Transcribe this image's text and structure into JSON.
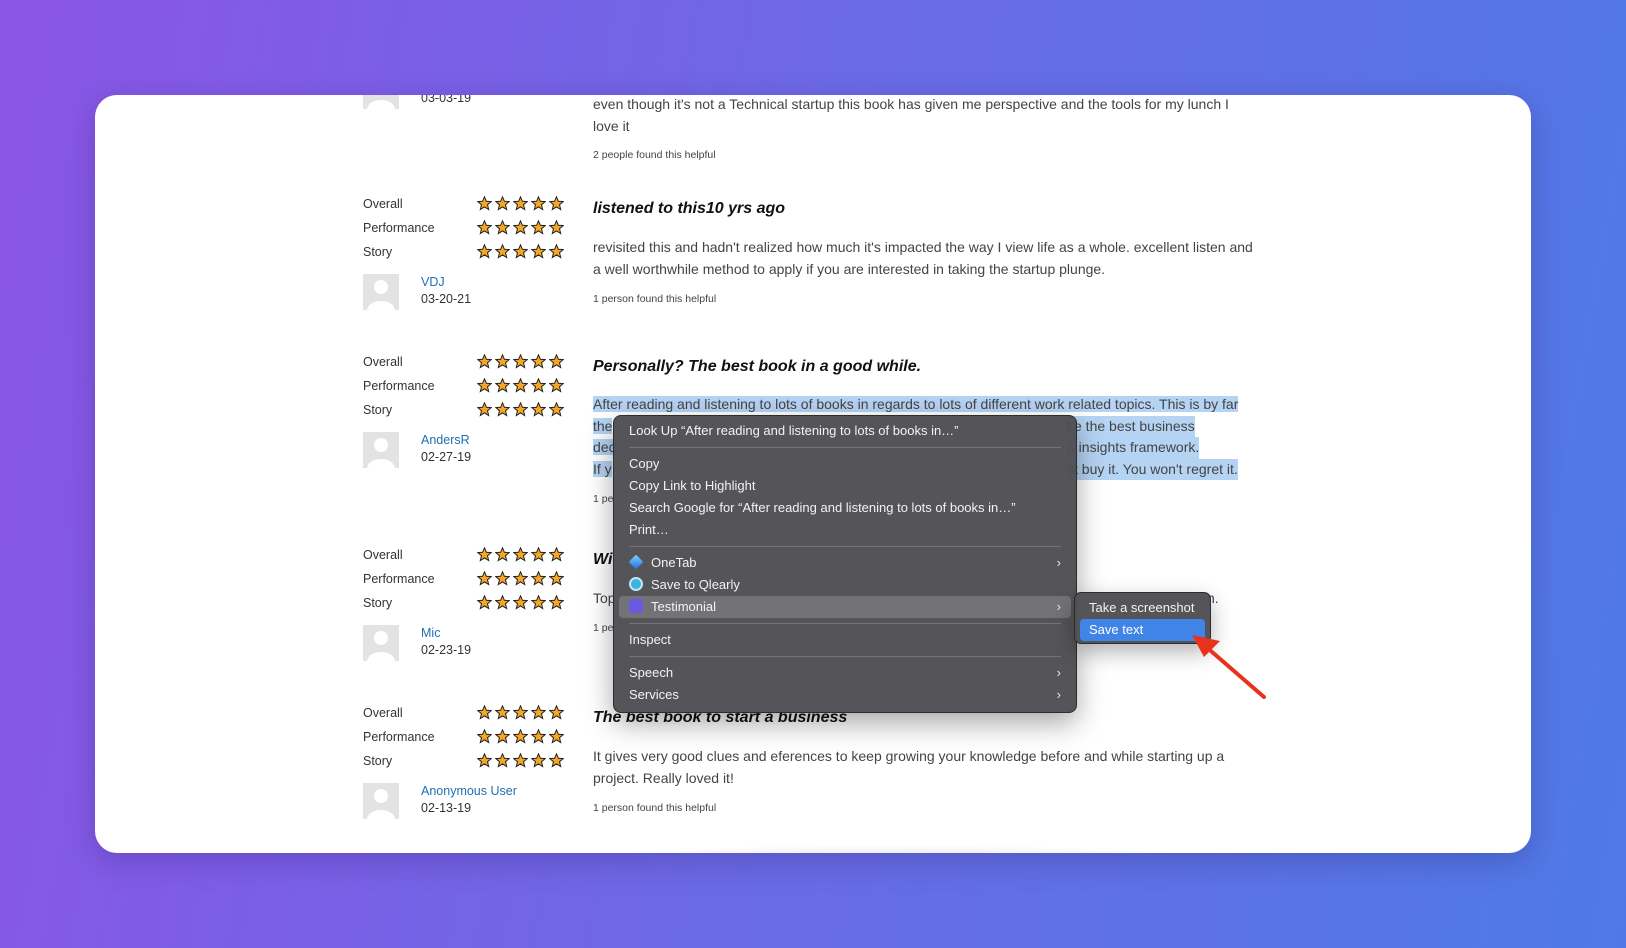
{
  "top_review": {
    "date_partial": "03-03-19",
    "body": "even though it's not a Technical startup this book has given me perspective and the tools for my lunch I love it",
    "helpful": "2 people found this helpful"
  },
  "rating_labels": {
    "overall": "Overall",
    "performance": "Performance",
    "story": "Story"
  },
  "reviews": [
    {
      "user": "VDJ",
      "date": "03-20-21",
      "title": "listened to this10 yrs ago",
      "body": "revisited this and hadn't realized how much it's impacted the way I view life as a whole. excellent listen and a well worthwhile method to apply if you are interested in taking the startup plunge.",
      "helpful": "1 person found this helpful",
      "ratings": {
        "overall": 5,
        "performance": 5,
        "story": 5
      }
    },
    {
      "user": "AndersR",
      "date": "02-27-19",
      "title": "Personally? The best book in a good while.",
      "body_line1_left": "After reading and listening to lots of books in regards to lots of different work related topics. This is by far",
      "body_line2_left": "the",
      "body_line2_right": "ke the best business",
      "body_line3_left": "dec",
      "body_line3_right": "n insights framework.",
      "body_line4_left": "If y",
      "body_line4_right": "st buy it. You won't regret it.",
      "helpful": "1 pe",
      "ratings": {
        "overall": 5,
        "performance": 5,
        "story": 5
      }
    },
    {
      "user": "Mic",
      "date": "02-23-19",
      "title": "Wi",
      "body_left": "Top",
      "body_right": "n.",
      "helpful": "1 pe",
      "ratings": {
        "overall": 5,
        "performance": 5,
        "story": 5
      }
    },
    {
      "user": "Anonymous User",
      "date": "02-13-19",
      "title": "The best book to start a business",
      "body": "It gives very good clues and eferences to keep growing your knowledge before and while starting up a project. Really loved it!",
      "helpful": "1 person found this helpful",
      "ratings": {
        "overall": 5,
        "performance": 5,
        "story": 5
      }
    }
  ],
  "context_menu": {
    "look_up": "Look Up “After reading and listening to lots of books in…”",
    "copy": "Copy",
    "copy_link": "Copy Link to Highlight",
    "search_google": "Search Google for “After reading and listening to lots of books in…”",
    "print": "Print…",
    "onetab": "OneTab",
    "save_qlearly": "Save to Qlearly",
    "testimonial": "Testimonial",
    "inspect": "Inspect",
    "speech": "Speech",
    "services": "Services"
  },
  "submenu": {
    "take_screenshot": "Take a screenshot",
    "save_text": "Save text"
  },
  "colors": {
    "star_fill": "#f5a623",
    "link": "#1f6fb5",
    "selection": "#b5d3f3",
    "menu_selected": "#3f84e6",
    "arrow": "#e8321e"
  }
}
